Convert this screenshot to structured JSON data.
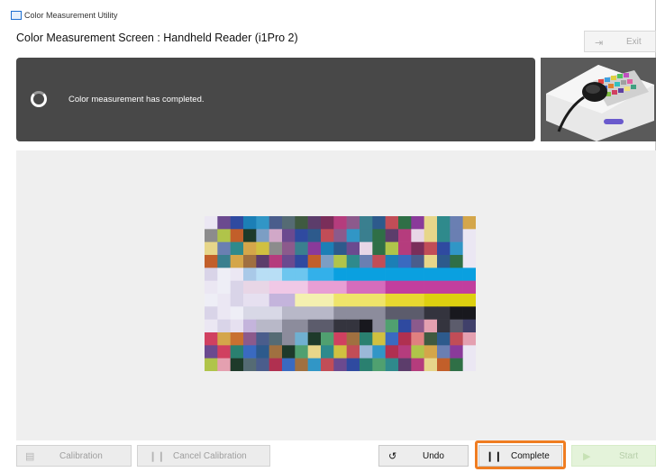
{
  "window": {
    "title": "Color Measurement Utility"
  },
  "header": {
    "screen_title": "Color Measurement Screen : Handheld Reader (i1Pro 2)",
    "exit_label": "Exit"
  },
  "status": {
    "message": "Color measurement has completed."
  },
  "device_image": {
    "icon": "i1pro-handheld-reader-illustration"
  },
  "patch_chart": {
    "columns": 21,
    "rows": 12,
    "palette": {
      "a": "#6b4a8f",
      "b": "#2f4aa0",
      "c": "#1c7fb6",
      "d": "#3196c6",
      "e": "#4a5d8c",
      "f": "#556b74",
      "g": "#3f5a40",
      "h": "#5c3d6b",
      "i": "#7a2e5a",
      "j": "#b53c7d",
      "k": "#8c5a8c",
      "l": "#3a7f8f",
      "m": "#2d5a8c",
      "n": "#c14d57",
      "o": "#2f6f46",
      "p": "#8a3a9a",
      "q": "#e7d68a",
      "r": "#2f8a8c",
      "s": "#6a7fb2",
      "t": "#d4a64a",
      "u": "#8c8c8c",
      "v": "#b0c44a",
      "w": "#c25f2a",
      "x": "#1e3a2a",
      "y": "#7c9ec4",
      "z": "#d1a8c8",
      "A": "#e8d6e6",
      "B": "#a9c9e8",
      "C": "#0aa0e0",
      "D": "#33b0ea",
      "E": "#6dc6ef",
      "F": "#b8def5",
      "G": "#f0c8e6",
      "H": "#e89ed4",
      "I": "#d66cbc",
      "J": "#c23e9e",
      "K": "#f4f0b0",
      "L": "#efe46a",
      "M": "#e8d830",
      "N": "#ddd010",
      "O": "#d8d8e6",
      "P": "#b8b8c8",
      "Q": "#8c8c9c",
      "R": "#5c5c6c",
      "S": "#34343e",
      "T": "#18181e",
      "U": "#e6e0f0",
      "V": "#c4b4dc",
      "W": "#d04060",
      "X": "#6f3a80",
      "Y": "#2a8070",
      "Z": "#3a6ac0",
      "0": "#e08080",
      "1": "#50a070",
      "2": "#a07040",
      "3": "#d0c040",
      "4": "#b03050",
      "5": "#70b0d0",
      "6": "#e4a0b0",
      "7": "#40406a",
      "8": "#c87030",
      "9": "#9ab8d8",
      "#": "#ebe7f3",
      "@": "#d9d4e8",
      "%": "#eeeef6"
    },
    "rows_codes": [
      "#abcdefghijklmnopqrst",
      "uvwxyzabmnkdlohjAqrs",
      "qsrt3uklpcmaAovjinbd",
      "wlt2hjabwyvrsncZeqmo",
      "@%#BFFEEDDCCCCCCCCCCC",
      "#%@AAGGGHHHIIIJJJJJJJ",
      "%#@UUVVKKKLLLLMMMNNNN",
      "@#%OOOPPPPQQQQRRRSSTT",
      "#@UVPPQQRRSSTQ1bk6SR7",
      "Wt8kefQ5x1W2Y3Z40gmn6",
      "aWYZm2x1qr3n9d4jvtsp",
      "v6xfe4Z2dnabY1rhjqwo"
    ]
  },
  "toolbar": {
    "calibration_label": "Calibration",
    "cancel_calibration_label": "Cancel Calibration",
    "undo_label": "Undo",
    "complete_label": "Complete",
    "start_label": "Start"
  },
  "colors": {
    "accent_highlight": "#ef7d22",
    "status_panel": "#484848",
    "start_button": "#e4f3da"
  }
}
